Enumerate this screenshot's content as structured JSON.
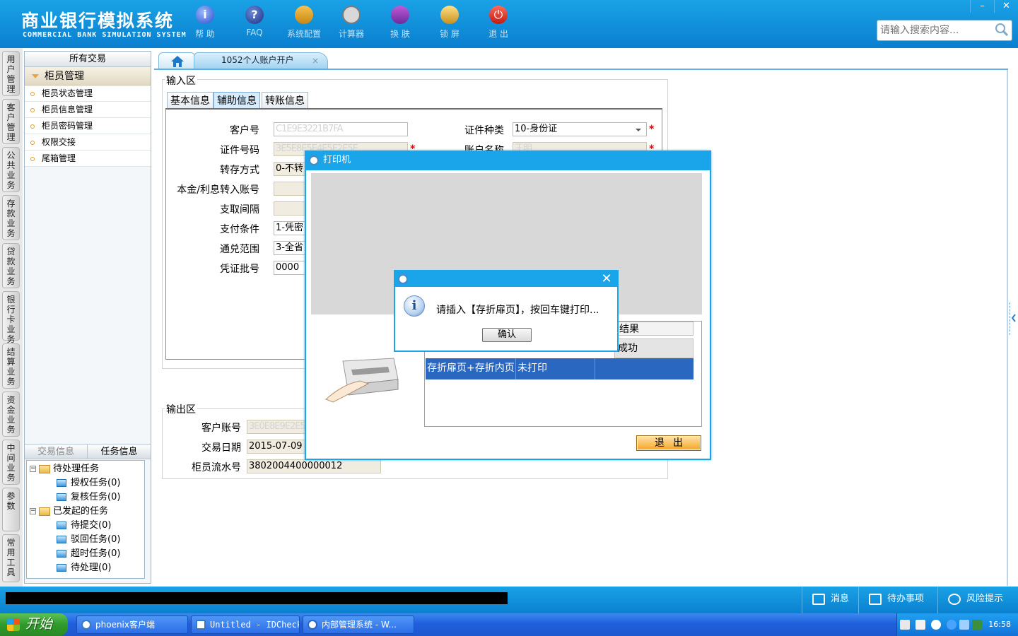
{
  "header": {
    "logo_cn": "商业银行模拟系统",
    "logo_en": "COMMERCIAL BANK SIMULATION SYSTEM",
    "toolbar": [
      {
        "label": "帮 助",
        "icon": "help-icon"
      },
      {
        "label": "FAQ",
        "icon": "faq-icon"
      },
      {
        "label": "系统配置",
        "icon": "config-icon"
      },
      {
        "label": "计算器",
        "icon": "calculator-icon"
      },
      {
        "label": "换 肤",
        "icon": "skin-icon"
      },
      {
        "label": "锁 屏",
        "icon": "lock-icon"
      },
      {
        "label": "退 出",
        "icon": "exit-icon"
      }
    ],
    "window_min": "–",
    "window_close": "✕",
    "search_placeholder": "请输入搜索内容..."
  },
  "vtabs": [
    "用户管理",
    "客户管理",
    "公共业务",
    "存款业务",
    "贷款业务",
    "银行卡业务",
    "结算业务",
    "资金业务",
    "中间业务",
    "参数",
    "常用工具"
  ],
  "left_panel": {
    "header": "所有交易",
    "group": "柜员管理",
    "items": [
      "柜员状态管理",
      "柜员信息管理",
      "柜员密码管理",
      "权限交接",
      "尾箱管理"
    ],
    "tabs": [
      "交易信息",
      "任务信息"
    ],
    "tree": {
      "pending": "待处理任务",
      "pending_children": [
        "授权任务(0)",
        "复核任务(0)"
      ],
      "initiated": "已发起的任务",
      "initiated_children": [
        "待提交(0)",
        "驳回任务(0)",
        "超时任务(0)",
        "待处理(0)"
      ]
    }
  },
  "main": {
    "tab_title": "1052个人账户开户",
    "tab_close": "×",
    "input_section": "输入区",
    "subtabs": [
      "基本信息",
      "辅助信息",
      "转账信息"
    ],
    "fields_left": [
      {
        "label": "客户号",
        "value": "C1E9E3221B7FA"
      },
      {
        "label": "证件号码",
        "value": "3E5E8E5E4E5E2E5E"
      },
      {
        "label": "转存方式",
        "value": "0-不转"
      },
      {
        "label": "本金/利息转入账号",
        "value": ""
      },
      {
        "label": "支取间隔",
        "value": ""
      },
      {
        "label": "支付条件",
        "value": "1-凭密"
      },
      {
        "label": "通兑范围",
        "value": "3-全省"
      },
      {
        "label": "凭证批号",
        "value": "0000"
      }
    ],
    "fields_right": [
      {
        "label": "证件种类",
        "value": "10-身份证"
      },
      {
        "label": "账户名称",
        "value": "王明"
      }
    ],
    "required_mark": "*",
    "output_section": "输出区",
    "output_fields": [
      {
        "label": "客户账号",
        "value": "3E0E8E9E2E5E"
      },
      {
        "label": "交易日期",
        "value": "2015-07-09"
      },
      {
        "label": "柜员流水号",
        "value": "3802004400000012"
      }
    ]
  },
  "printer_dialog": {
    "title": "打印机",
    "col_result": "结果",
    "row1_result": "成功",
    "row2": [
      "存折扉页+存折内页",
      "未打印",
      ""
    ],
    "exit_label": "退出"
  },
  "confirm_dialog": {
    "close": "✕",
    "info_glyph": "i",
    "message": "请插入【存折扉页】，按回车键打印...",
    "ok_label": "确认"
  },
  "statusbar": {
    "message": "消息",
    "todo": "待办事项",
    "risk": "风险提示"
  },
  "taskbar": {
    "start": "开始",
    "items": [
      "phoenix客户端",
      "Untitled - IDCheck",
      "内部管理系统 - W..."
    ],
    "clock": "16:58"
  },
  "colors": {
    "header_blue": "#0a7fcf",
    "dialog_border": "#1aa5ea",
    "selected_row": "#2a67c1",
    "required_red": "#e00000"
  }
}
